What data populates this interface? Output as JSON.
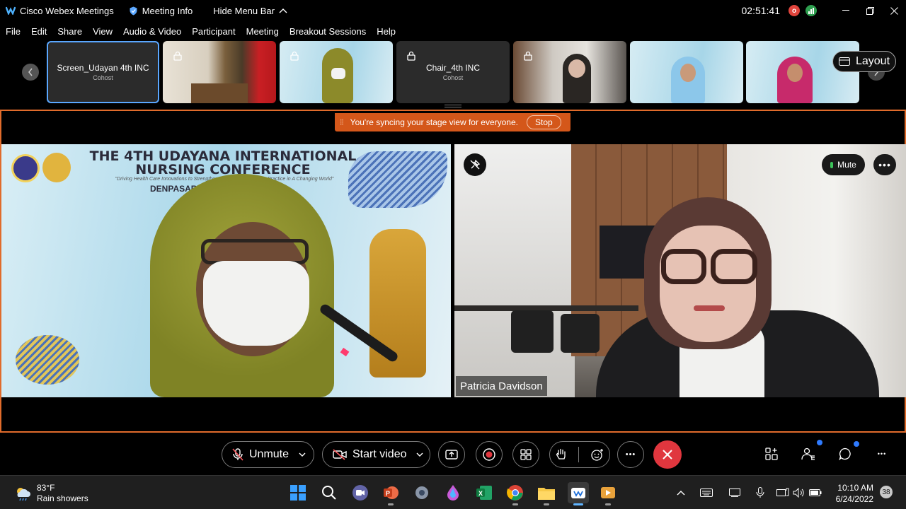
{
  "titlebar": {
    "app_name": "Cisco Webex Meetings",
    "meeting_info": "Meeting Info",
    "hide_menu_bar": "Hide Menu Bar",
    "clock": "02:51:41",
    "rec_letter": "o"
  },
  "menu": [
    "File",
    "Edit",
    "Share",
    "View",
    "Audio & Video",
    "Participant",
    "Meeting",
    "Breakout Sessions",
    "Help"
  ],
  "filmstrip": {
    "tiles": [
      {
        "name": "Screen_Udayan 4th INC",
        "role": "Cohost"
      },
      {
        "name": "Chair_4th INC",
        "role": "Cohost"
      }
    ],
    "thumb_conf_title": "THE 4TH UDAYANA INTERNATIONAL NURSING CONFERENCE",
    "layout_label": "Layout"
  },
  "banner": {
    "message": "You're syncing your stage view for everyone.",
    "stop_label": "Stop"
  },
  "stage": {
    "conference_title_line1": "THE 4TH UDAYANA INTERNATIONAL",
    "conference_title_line2": "NURSING CONFERENCE",
    "conference_subtitle": "\"Driving Health Care Innovations to Strengthen Resilience of Nursing Practice in A Changing World\"",
    "conference_place": "DENPASAR, BALI",
    "speaker_name": "Patricia Davidson",
    "mute_label": "Mute"
  },
  "controls": {
    "unmute_label": "Unmute",
    "start_video_label": "Start video"
  },
  "taskbar": {
    "temperature": "83°F",
    "weather": "Rain showers",
    "time": "10:10 AM",
    "date": "6/24/2022",
    "notifications": "38"
  },
  "colors": {
    "accent_orange": "#d4571a",
    "end_call_red": "#e0363e",
    "selected_border": "#5aa7ff",
    "badge_blue": "#2f7bff"
  }
}
